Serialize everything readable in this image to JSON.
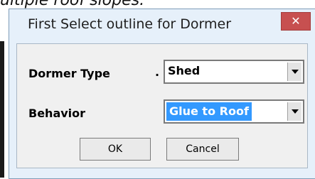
{
  "background": {
    "text": "ultiple roof slopes."
  },
  "dialog": {
    "title": "First Select outline for Dormer",
    "close_glyph": "✕",
    "accent_color": "#c75050",
    "fields": {
      "dormer_type": {
        "label": "Dormer Type",
        "prefix": ".",
        "value": "Shed"
      },
      "behavior": {
        "label": "Behavior",
        "value": "Glue to Roof"
      }
    },
    "buttons": {
      "ok": "OK",
      "cancel": "Cancel"
    }
  }
}
